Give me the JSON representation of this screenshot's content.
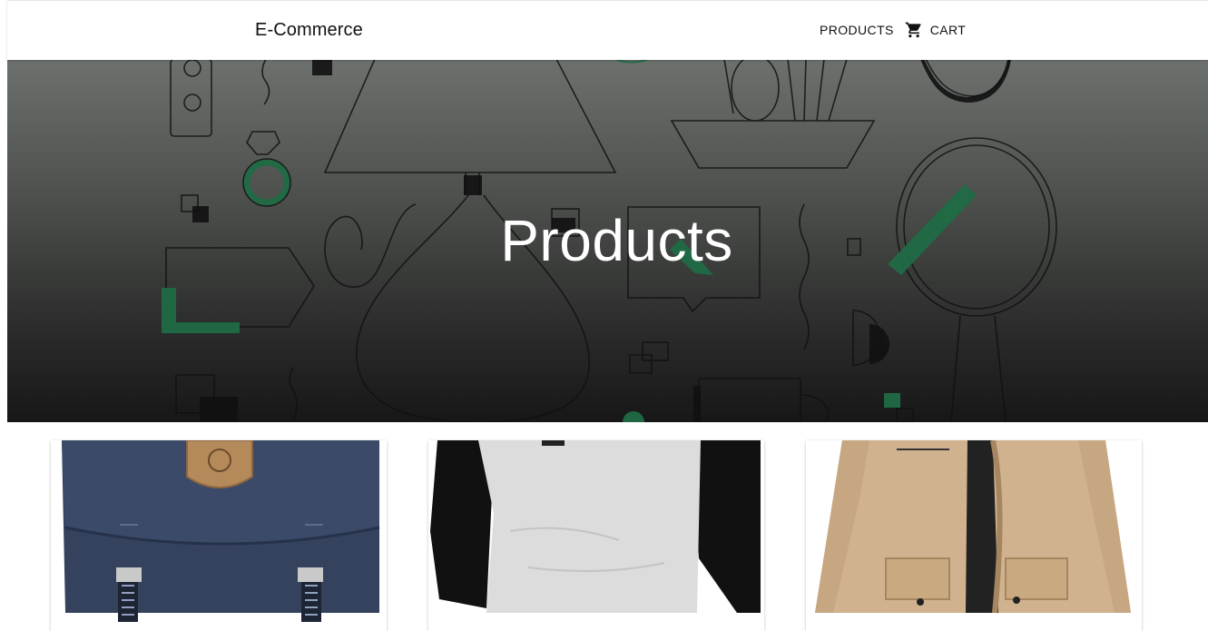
{
  "appbar": {
    "brand": "E-Commerce",
    "nav": {
      "products_label": "PRODUCTS",
      "cart_label": "CART",
      "cart_icon": "shopping-cart-icon"
    }
  },
  "hero": {
    "title": "Products"
  },
  "colors": {
    "accent_green": "#1f6b45",
    "appbar_bg": "#ffffff",
    "text": "#111111"
  },
  "products": [
    {
      "icon": "backpack-image"
    },
    {
      "icon": "raglan-shirt-image"
    },
    {
      "icon": "jacket-image"
    }
  ]
}
